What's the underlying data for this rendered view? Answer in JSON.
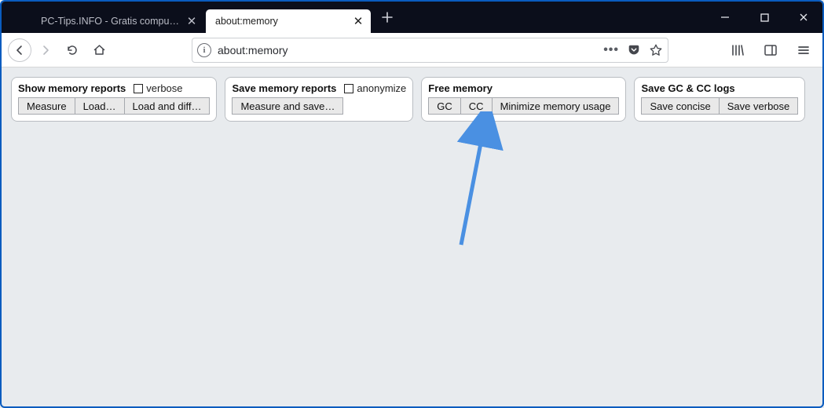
{
  "window": {
    "tabs": [
      {
        "title": "PC-Tips.INFO - Gratis computer tips",
        "active": false
      },
      {
        "title": "about:memory",
        "active": true
      }
    ],
    "url": "about:memory"
  },
  "panels": {
    "show": {
      "title": "Show memory reports",
      "checkbox_label": "verbose",
      "buttons": {
        "measure": "Measure",
        "load": "Load…",
        "load_diff": "Load and diff…"
      }
    },
    "save": {
      "title": "Save memory reports",
      "checkbox_label": "anonymize",
      "buttons": {
        "measure_save": "Measure and save…"
      }
    },
    "free": {
      "title": "Free memory",
      "buttons": {
        "gc": "GC",
        "cc": "CC",
        "minimize": "Minimize memory usage"
      }
    },
    "logs": {
      "title": "Save GC & CC logs",
      "buttons": {
        "concise": "Save concise",
        "verbose": "Save verbose"
      }
    }
  }
}
